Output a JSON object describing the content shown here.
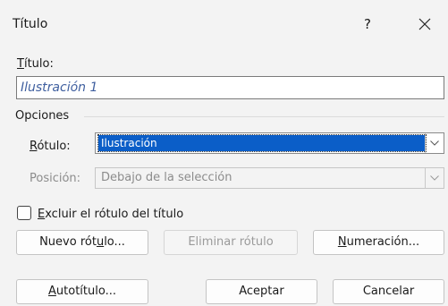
{
  "window": {
    "title": "Título",
    "help_label": "?"
  },
  "form": {
    "title_label": "Título:",
    "title_value": "Ilustración 1",
    "options_label": "Opciones",
    "label_label": "Rótulo:",
    "label_value": "Ilustración",
    "position_label": "Posición:",
    "position_value": "Debajo de la selección",
    "exclude_label": "Excluir el rótulo del título",
    "exclude_checked": false
  },
  "buttons": {
    "new_label": "Nuevo rótulo...",
    "delete_label": "Eliminar rótulo",
    "numbering": "Numeración...",
    "autocaption": "Autotítulo...",
    "ok": "Aceptar",
    "cancel": "Cancelar"
  },
  "icons": {
    "close": "close-icon",
    "dropdown": "chevron-down-icon"
  }
}
